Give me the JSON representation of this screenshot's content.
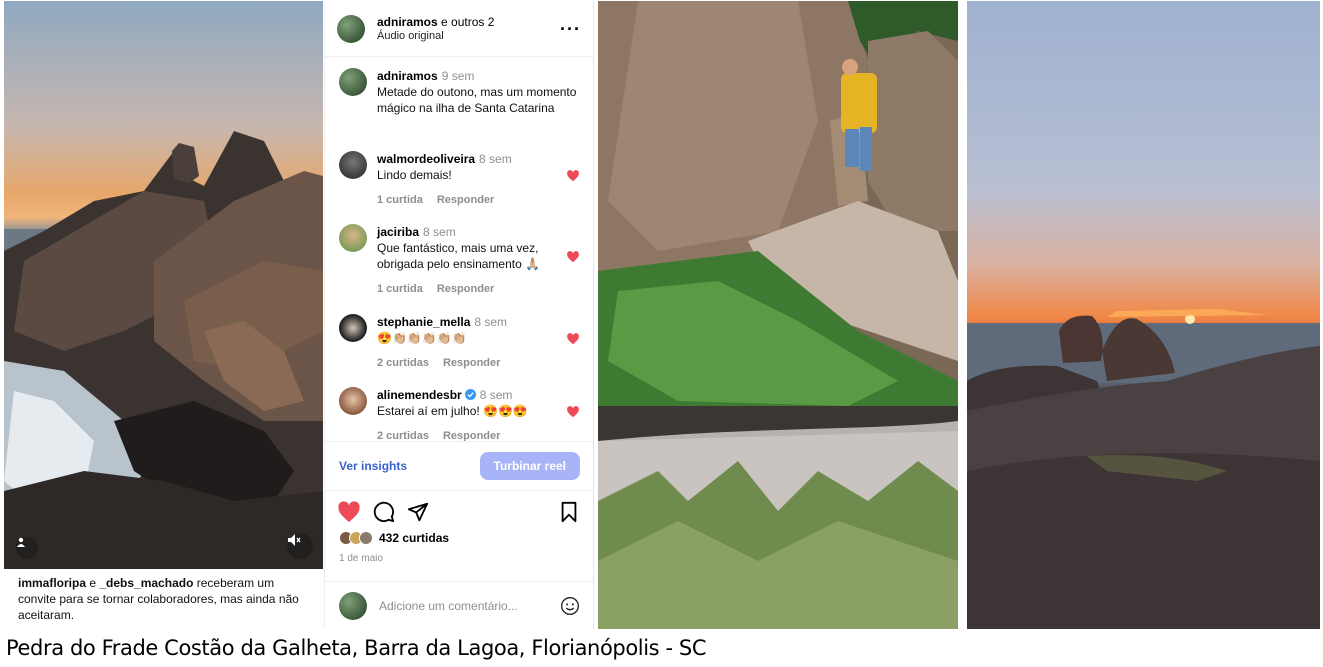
{
  "colors": {
    "like_red": "#ed4956",
    "link_blue": "#3a5fcf",
    "boost_bg": "#a7b4f7",
    "muted": "#8e8e8e"
  },
  "reel": {
    "user_icon": "person-icon",
    "mute_icon": "muted-speaker-icon",
    "collab_note": {
      "user1": "immafloripa",
      "and": " e ",
      "user2": "_debs_machado",
      "rest": " receberam um convite para se tornar colaboradores, mas ainda não aceitaram."
    }
  },
  "header": {
    "account": "adniramos",
    "others": " e outros 2",
    "audio": "Áudio original",
    "more_icon": "more-options-icon"
  },
  "comments": [
    {
      "user": "adniramos",
      "time": "9 sem",
      "text": "Metade do outono, mas um momento mágico na ilha de Santa Catarina"
    },
    {
      "user": "walmordeoliveira",
      "time": "8 sem",
      "text": "Lindo demais!",
      "likes": "1 curtida",
      "reply": "Responder"
    },
    {
      "user": "jaciriba",
      "time": "8 sem",
      "text": "Que fantástico, mais uma vez, obrigada pelo ensinamento 🙏🏼",
      "likes": "1 curtida",
      "reply": "Responder"
    },
    {
      "user": "stephanie_mella",
      "time": "8 sem",
      "text": "😍👏🏼👏🏼👏🏼👏🏼👏🏼",
      "likes": "2 curtidas",
      "reply": "Responder"
    },
    {
      "user": "alinemendesbr",
      "time": "8 sem",
      "text": "Estarei aí em julho! 😍😍😍",
      "likes": "2 curtidas",
      "reply": "Responder"
    }
  ],
  "insights": {
    "link": "Ver insights",
    "boost": "Turbinar reel"
  },
  "actions": {
    "like_icon": "heart-filled-icon",
    "comment_icon": "comment-icon",
    "share_icon": "send-icon",
    "save_icon": "bookmark-icon"
  },
  "likes": {
    "count": "432 curtidas",
    "date": "1 de maio"
  },
  "add_comment": {
    "placeholder": "Adicione um comentário...",
    "emoji_icon": "emoji-icon"
  },
  "caption": "Pedra do Frade Costão da Galheta, Barra da Lagoa, Florianópolis - SC"
}
